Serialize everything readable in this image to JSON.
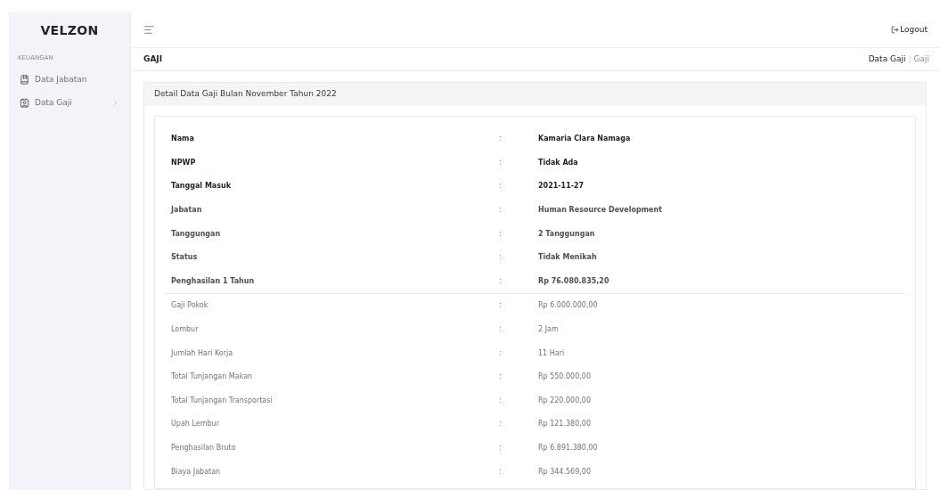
{
  "sidebar": {
    "logo": "VELZON",
    "section_title": "KEUANGAN",
    "items": [
      {
        "label": "Data Jabatan",
        "has_submenu": false
      },
      {
        "label": "Data Gaji",
        "has_submenu": true
      }
    ]
  },
  "topbar": {
    "logout": "Logout"
  },
  "page_header": {
    "title": "GAJI",
    "breadcrumb": [
      "Data Gaji",
      "Gaji"
    ]
  },
  "card": {
    "title": "Detail Data Gaji Bulan November Tahun 2022",
    "sections": [
      {
        "rows": [
          {
            "label": "Nama",
            "value": "Kamaria Clara Namaga",
            "kind": "key"
          },
          {
            "label": "NPWP",
            "value": "Tidak Ada",
            "kind": "key"
          },
          {
            "label": "Tanggal Masuk",
            "value": "2021-11-27",
            "kind": "key"
          },
          {
            "label": "Jabatan",
            "value": "Human Resource Development",
            "kind": "info"
          },
          {
            "label": "Tanggungan",
            "value": "2 Tanggungan",
            "kind": "info"
          },
          {
            "label": "Status",
            "value": "Tidak Menikah",
            "kind": "info"
          },
          {
            "label": "Penghasilan 1 Tahun",
            "value": "Rp 76.080.835,20",
            "kind": "info"
          }
        ]
      },
      {
        "rows": [
          {
            "label": "Gaji Pokok",
            "value": "Rp 6.000.000,00",
            "kind": "detail"
          },
          {
            "label": "Lembur",
            "value": "2 Jam",
            "kind": "detail"
          },
          {
            "label": "Jumlah Hari Kerja",
            "value": "11 Hari",
            "kind": "detail"
          },
          {
            "label": "Total Tunjangan Makan",
            "value": "Rp 550.000,00",
            "kind": "detail"
          },
          {
            "label": "Total Tunjangan Transportasi",
            "value": "Rp 220.000,00",
            "kind": "detail"
          },
          {
            "label": "Upah Lembur",
            "value": "Rp 121.380,00",
            "kind": "detail"
          },
          {
            "label": "Penghasilan Bruto",
            "value": "Rp 6.891.380,00",
            "kind": "detail"
          },
          {
            "label": "Biaya Jabatan",
            "value": "Rp 344.569,00",
            "kind": "detail"
          }
        ]
      }
    ],
    "separator": ":"
  }
}
